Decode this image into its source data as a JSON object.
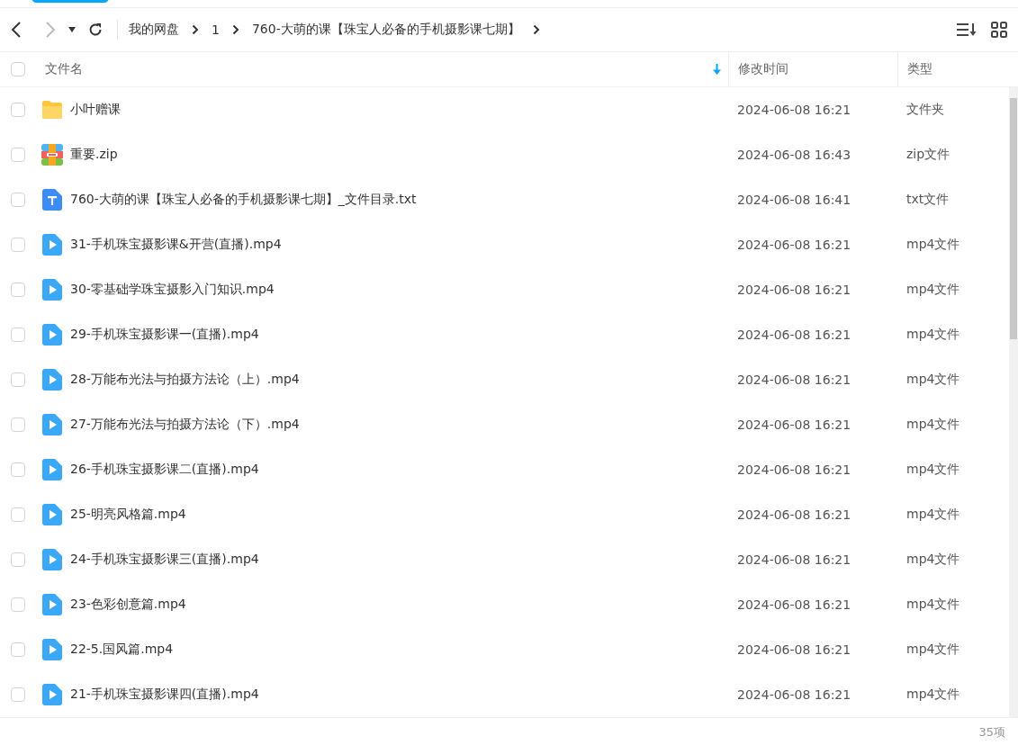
{
  "breadcrumb": [
    "我的网盘",
    "1",
    "760-大萌的课【珠宝人必备的手机摄影课七期】"
  ],
  "columns": [
    "文件名",
    "修改时间",
    "类型"
  ],
  "rows": [
    {
      "kind": "folder",
      "name": "小叶赠课",
      "modified": "2024-06-08 16:21",
      "type": "文件夹",
      "checked": false
    },
    {
      "kind": "zip",
      "name": "重要.zip",
      "modified": "2024-06-08 16:43",
      "type": "zip文件",
      "checked": false
    },
    {
      "kind": "txt",
      "name": "760-大萌的课【珠宝人必备的手机摄影课七期】_文件目录.txt",
      "modified": "2024-06-08 16:41",
      "type": "txt文件",
      "checked": false
    },
    {
      "kind": "video",
      "name": "31-手机珠宝摄影课&开营(直播).mp4",
      "modified": "2024-06-08 16:21",
      "type": "mp4文件",
      "checked": false
    },
    {
      "kind": "video",
      "name": "30-零基础学珠宝摄影入门知识.mp4",
      "modified": "2024-06-08 16:21",
      "type": "mp4文件",
      "checked": false
    },
    {
      "kind": "video",
      "name": "29-手机珠宝摄影课一(直播).mp4",
      "modified": "2024-06-08 16:21",
      "type": "mp4文件",
      "checked": false
    },
    {
      "kind": "video",
      "name": "28-万能布光法与拍摄方法论（上）.mp4",
      "modified": "2024-06-08 16:21",
      "type": "mp4文件",
      "checked": false
    },
    {
      "kind": "video",
      "name": "27-万能布光法与拍摄方法论（下）.mp4",
      "modified": "2024-06-08 16:21",
      "type": "mp4文件",
      "checked": false
    },
    {
      "kind": "video",
      "name": "26-手机珠宝摄影课二(直播).mp4",
      "modified": "2024-06-08 16:21",
      "type": "mp4文件",
      "checked": false
    },
    {
      "kind": "video",
      "name": "25-明亮风格篇.mp4",
      "modified": "2024-06-08 16:21",
      "type": "mp4文件",
      "checked": false
    },
    {
      "kind": "video",
      "name": "24-手机珠宝摄影课三(直播).mp4",
      "modified": "2024-06-08 16:21",
      "type": "mp4文件",
      "checked": false
    },
    {
      "kind": "video",
      "name": "23-色彩创意篇.mp4",
      "modified": "2024-06-08 16:21",
      "type": "mp4文件",
      "checked": false
    },
    {
      "kind": "video",
      "name": "22-5.国风篇.mp4",
      "modified": "2024-06-08 16:21",
      "type": "mp4文件",
      "checked": false
    },
    {
      "kind": "video",
      "name": "21-手机珠宝摄影课四(直播).mp4",
      "modified": "2024-06-08 16:21",
      "type": "mp4文件",
      "checked": false
    }
  ],
  "select_all": {
    "checked": false
  },
  "footer": {
    "count": "35项"
  }
}
